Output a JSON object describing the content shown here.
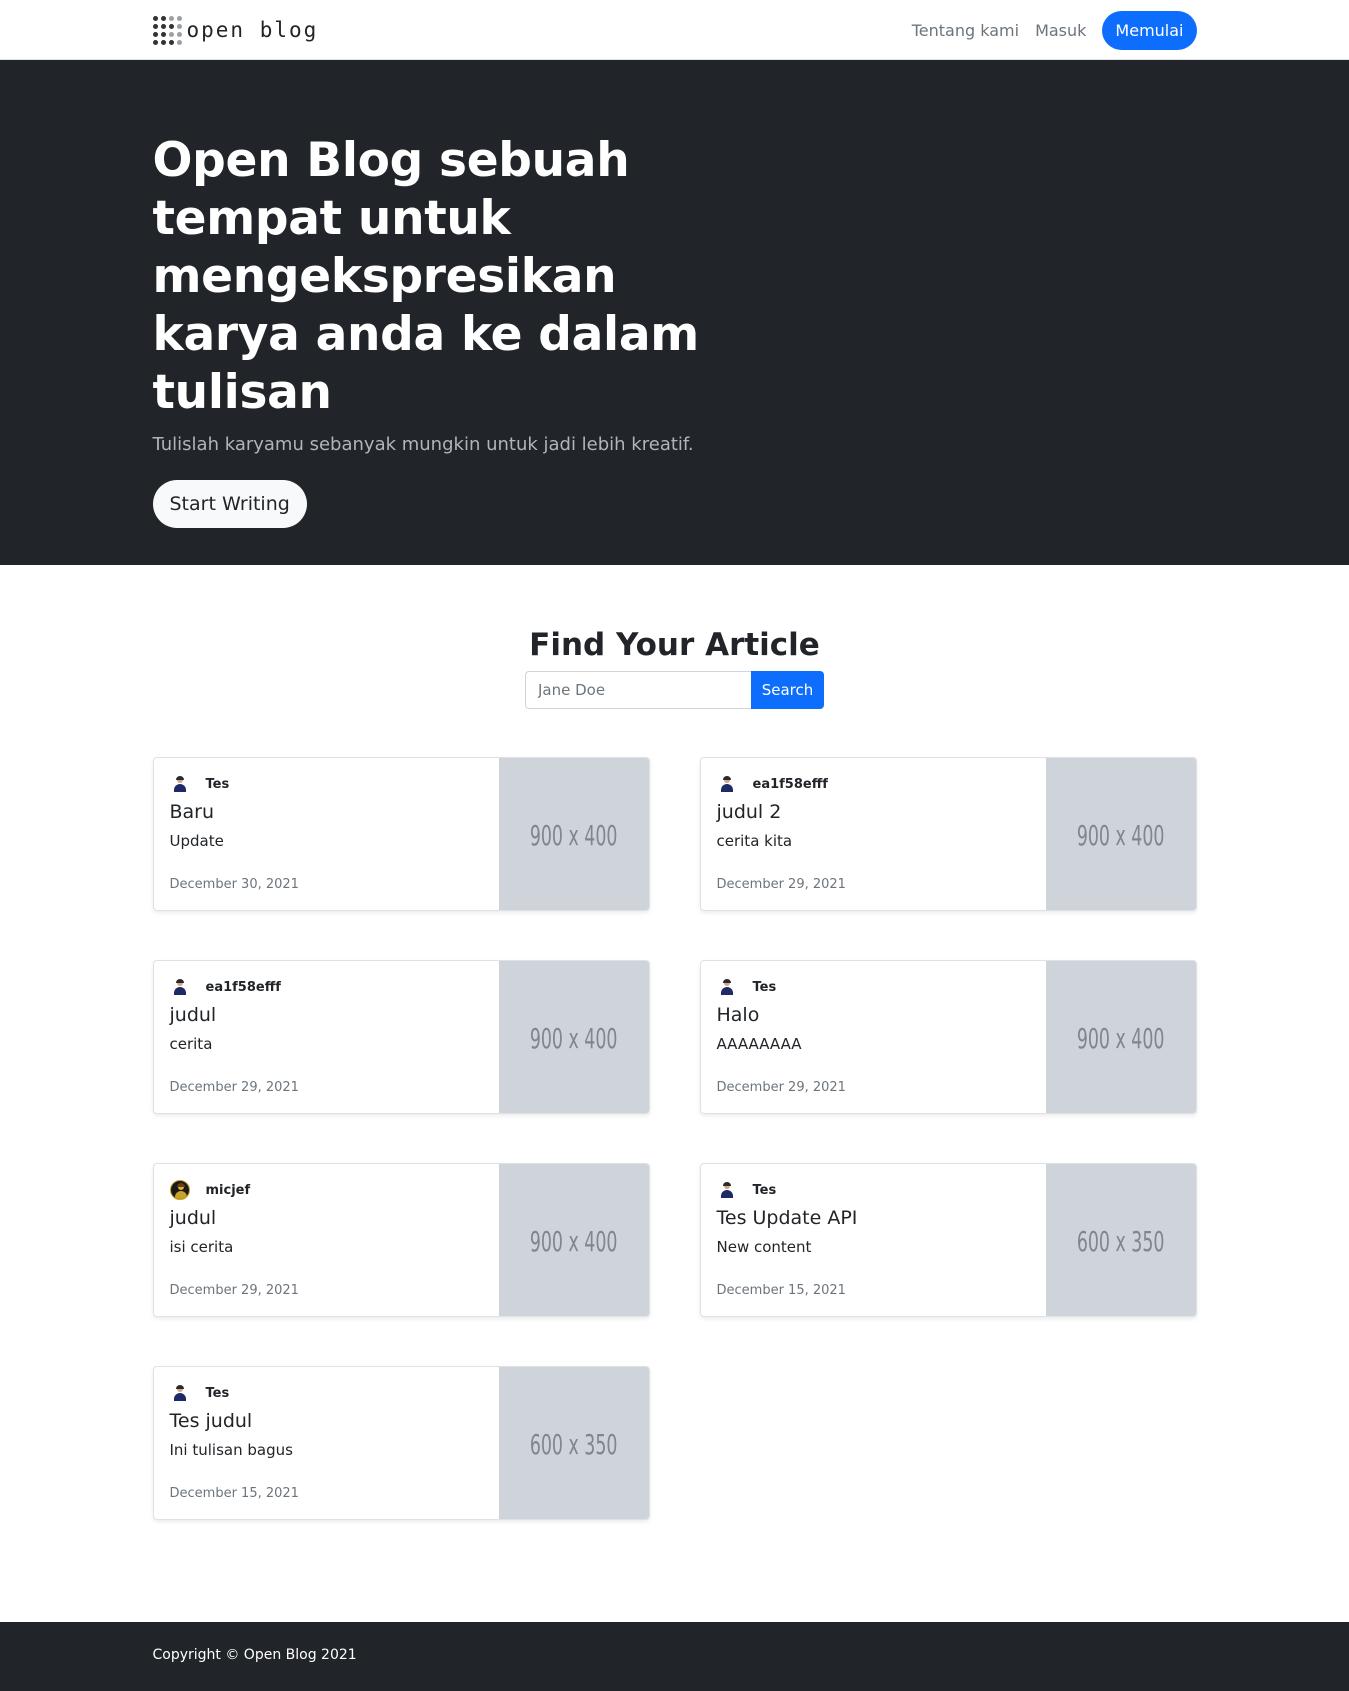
{
  "nav": {
    "brand": "open blog",
    "about": "Tentang kami",
    "login": "Masuk",
    "start": "Memulai"
  },
  "hero": {
    "title": "Open Blog sebuah tempat untuk mengekspresikan karya anda ke dalam tulisan",
    "lead": "Tulislah karyamu sebanyak mungkin untuk jadi lebih kreatif.",
    "cta": "Start Writing"
  },
  "search": {
    "title": "Find Your Article",
    "placeholder": "Jane Doe",
    "button": "Search"
  },
  "articles": [
    {
      "author": "Tes",
      "avatar": "man-avatar-icon",
      "title": "Baru",
      "text": "Update",
      "date": "December 30, 2021",
      "image": "900 x 400"
    },
    {
      "author": "ea1f58efff",
      "avatar": "man-avatar-icon",
      "title": "judul 2",
      "text": "cerita kita",
      "date": "December 29, 2021",
      "image": "900 x 400"
    },
    {
      "author": "ea1f58efff",
      "avatar": "man-avatar-icon",
      "title": "judul",
      "text": "cerita",
      "date": "December 29, 2021",
      "image": "900 x 400"
    },
    {
      "author": "Tes",
      "avatar": "man-avatar-icon",
      "title": "Halo",
      "text": "AAAAAAAA",
      "date": "December 29, 2021",
      "image": "900 x 400"
    },
    {
      "author": "micjef",
      "avatar": "custom-avatar-icon",
      "title": "judul",
      "text": "isi cerita",
      "date": "December 29, 2021",
      "image": "900 x 400"
    },
    {
      "author": "Tes",
      "avatar": "man-avatar-icon",
      "title": "Tes Update API",
      "text": "New content",
      "date": "December 15, 2021",
      "image": "600 x 350"
    },
    {
      "author": "Tes",
      "avatar": "man-avatar-icon",
      "title": "Tes judul",
      "text": "Ini tulisan bagus",
      "date": "December 15, 2021",
      "image": "600 x 350"
    }
  ],
  "footer": {
    "copyright": "Copyright © Open Blog 2021"
  },
  "colors": {
    "primary": "#0d6efd",
    "dark": "#212529",
    "placeholder_bg": "#cfd4db"
  }
}
